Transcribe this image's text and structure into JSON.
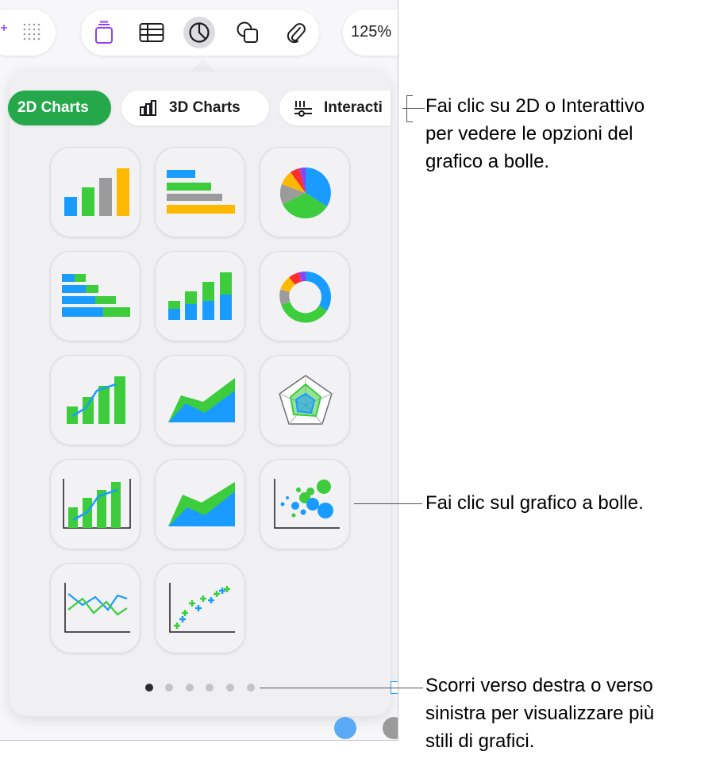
{
  "toolbar": {
    "zoom_label": "125%",
    "tools": [
      "text-icon",
      "table-icon",
      "chart-icon",
      "shape-icon",
      "attachment-icon"
    ],
    "active_tool": "chart-icon"
  },
  "chart_popover": {
    "tabs": [
      {
        "label": "2D Charts",
        "selected": true
      },
      {
        "label": "3D Charts",
        "selected": false
      },
      {
        "label": "Interactive",
        "selected": false
      }
    ],
    "visible_tab_labels": {
      "interactive": "Interacti"
    },
    "chart_types": [
      "column-chart",
      "bar-chart",
      "pie-chart",
      "stacked-bar-chart",
      "stacked-column-chart",
      "donut-chart",
      "mixed-chart",
      "area-chart",
      "radar-chart",
      "two-axis-chart",
      "stacked-area-chart",
      "bubble-chart",
      "line-chart",
      "scatter-chart"
    ],
    "page_count": 6,
    "current_page": 1
  },
  "colors": {
    "green": "#3ccc3c",
    "blue": "#1a9bff",
    "gray": "#9b9b9b",
    "yellow": "#ffb800",
    "red": "#ff2d2d",
    "purple": "#8e44ef",
    "selected_tab": "#25a84a"
  },
  "callouts": {
    "tabs_line1": "Fai clic su 2D o Interattivo",
    "tabs_line2": "per vedere le opzioni del",
    "tabs_line3": "grafico a bolle.",
    "bubble": "Fai clic sul grafico a bolle.",
    "scroll_line1": "Scorri verso destra o verso",
    "scroll_line2": "sinistra per visualizzare più",
    "scroll_line3": "stili di grafici."
  }
}
